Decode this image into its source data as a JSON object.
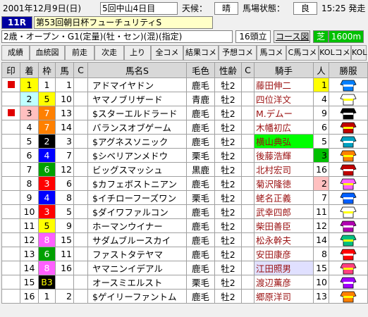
{
  "header": {
    "date": "2001年12月",
    "day": "9日(日)",
    "meeting": "5回中山4日目",
    "weather_label": "天候：",
    "weather": "晴",
    "track_label": "馬場状態：",
    "track": "良",
    "post_time": "15:25 発走"
  },
  "race": {
    "number": "11R",
    "title": "第53回朝日杯フューチュリティS"
  },
  "conditions": {
    "text": "2歳・オープン・G1(定量)(牡・セン)(混)(指定)",
    "runners": "16頭立",
    "course_btn": "コース図",
    "surface": "芝",
    "distance": "1600m"
  },
  "tabs": [
    "成績",
    "血統図",
    "前走",
    "次走",
    "上り",
    "全コメ",
    "結果コメ",
    "予想コメ",
    "馬コメ",
    "C馬コメ",
    "KOLコメ",
    "KOL"
  ],
  "columns": [
    "印",
    "着",
    "枠",
    "馬",
    "C",
    "馬名S",
    "毛色",
    "性齢",
    "C",
    "騎手",
    "人",
    "勝服"
  ],
  "colors": {
    "frame1": "#ffffff",
    "frame2": "#000000",
    "frame3": "#ff0000",
    "frame4": "#0000ff",
    "frame5": "#ffff00",
    "frame6": "#00a000",
    "frame7": "#ff8000",
    "frame8": "#ff60ff",
    "mark": "#e00000",
    "pop1": "#ffff00",
    "pop2": "#ffc0c0",
    "pop3": "#00c000",
    "jockey_hl": "#00ff00"
  },
  "rows": [
    {
      "mark": "■",
      "pos": "1",
      "frame": "1",
      "num": "1",
      "name": "アドマイヤドン",
      "color": "鹿毛",
      "sexage": "牡2",
      "jockey": "藤田伸二",
      "pop": "1"
    },
    {
      "mark": "",
      "pos": "2",
      "frame": "5",
      "num": "10",
      "name": "ヤマノブリザード",
      "color": "青鹿",
      "sexage": "牡2",
      "jockey": "四位洋文",
      "pop": "4"
    },
    {
      "mark": "■",
      "pos": "3",
      "frame": "7",
      "num": "13",
      "name": "$スターエルドラード",
      "color": "鹿毛",
      "sexage": "牡2",
      "jockey": "M.デムー",
      "pop": "9"
    },
    {
      "mark": "",
      "pos": "4",
      "frame": "7",
      "num": "14",
      "name": "バランスオブゲーム",
      "color": "鹿毛",
      "sexage": "牡2",
      "jockey": "木幡初広",
      "pop": "6"
    },
    {
      "mark": "",
      "pos": "5",
      "frame": "2",
      "num": "3",
      "name": "$アグネスソニック",
      "color": "鹿毛",
      "sexage": "牡2",
      "jockey": "横山典弘",
      "pop": "5"
    },
    {
      "mark": "",
      "pos": "6",
      "frame": "4",
      "num": "7",
      "name": "$シベリアンメドウ",
      "color": "栗毛",
      "sexage": "牡2",
      "jockey": "後藤浩輝",
      "pop": "3"
    },
    {
      "mark": "",
      "pos": "7",
      "frame": "6",
      "num": "12",
      "name": "ビッグスマッシュ",
      "color": "黒鹿",
      "sexage": "牡2",
      "jockey": "北村宏司",
      "pop": "16"
    },
    {
      "mark": "",
      "pos": "8",
      "frame": "3",
      "num": "6",
      "name": "$カフェボストニアン",
      "color": "鹿毛",
      "sexage": "牡2",
      "jockey": "菊沢隆徳",
      "pop": "2"
    },
    {
      "mark": "",
      "pos": "9",
      "frame": "4",
      "num": "8",
      "name": "$イチローフーズワン",
      "color": "栗毛",
      "sexage": "牡2",
      "jockey": "蛯名正義",
      "pop": "7"
    },
    {
      "mark": "",
      "pos": "10",
      "frame": "3",
      "num": "5",
      "name": "$ダイワファルコン",
      "color": "鹿毛",
      "sexage": "牡2",
      "jockey": "武幸四郎",
      "pop": "11"
    },
    {
      "mark": "",
      "pos": "11",
      "frame": "5",
      "num": "9",
      "name": "ホーマンウイナー",
      "color": "鹿毛",
      "sexage": "牡2",
      "jockey": "柴田善臣",
      "pop": "12"
    },
    {
      "mark": "",
      "pos": "12",
      "frame": "8",
      "num": "15",
      "name": "サダムブルースカイ",
      "color": "鹿毛",
      "sexage": "牡2",
      "jockey": "松永幹夫",
      "pop": "14"
    },
    {
      "mark": "",
      "pos": "13",
      "frame": "6",
      "num": "11",
      "name": "ファストタテヤマ",
      "color": "鹿毛",
      "sexage": "牡2",
      "jockey": "安田康彦",
      "pop": "8"
    },
    {
      "mark": "",
      "pos": "14",
      "frame": "8",
      "num": "16",
      "name": "ヤマニンイデアル",
      "color": "鹿毛",
      "sexage": "牡2",
      "jockey": "江田照男",
      "pop": "15"
    },
    {
      "mark": "",
      "pos": "15",
      "frame": "B3",
      "num": "",
      "name": "オースミエルスト",
      "color": "栗毛",
      "sexage": "牡2",
      "jockey": "渡辺薫彦",
      "pop": "10"
    },
    {
      "mark": "",
      "pos": "16",
      "frame": "1",
      "num": "2",
      "name": "$ゲイリーファントム",
      "color": "鹿毛",
      "sexage": "牡2",
      "jockey": "郷原洋司",
      "pop": "13"
    }
  ]
}
